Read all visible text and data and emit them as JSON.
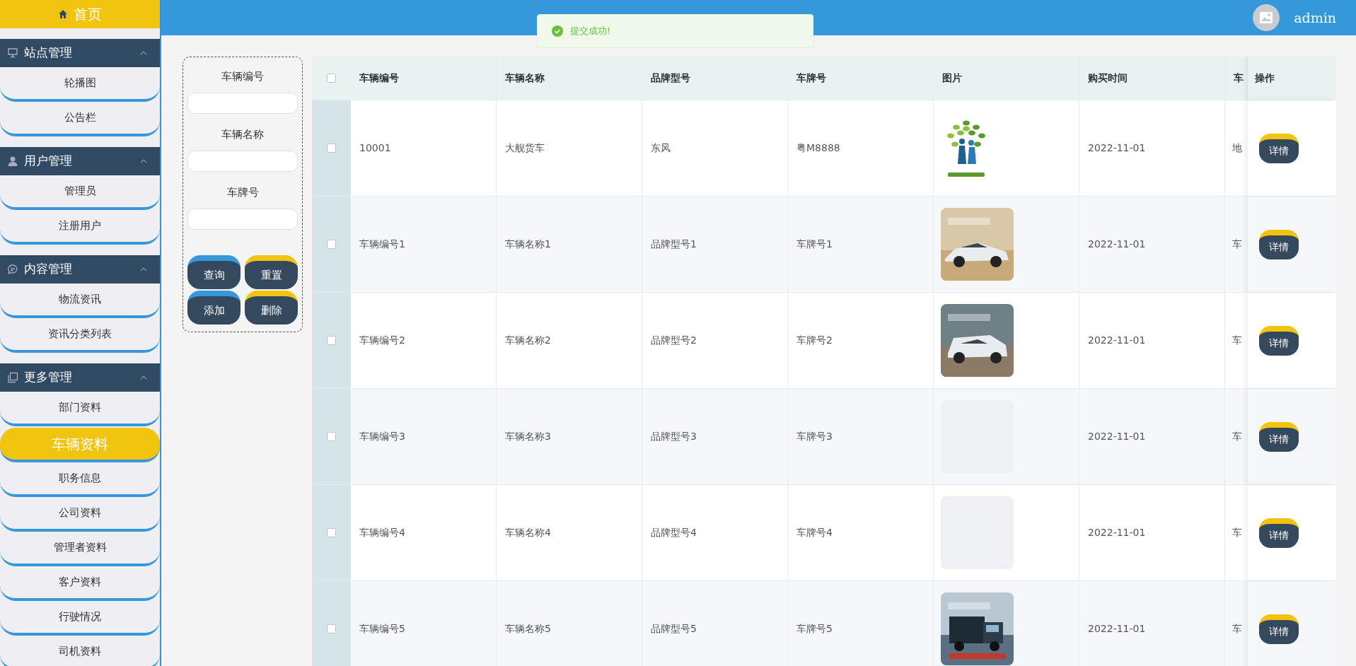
{
  "sidebar": {
    "home": {
      "label": "首页"
    },
    "groups": [
      {
        "title": "站点管理",
        "expanded": true,
        "items": [
          {
            "label": "轮播图",
            "selected": false
          },
          {
            "label": "公告栏",
            "selected": false
          }
        ]
      },
      {
        "title": "用户管理",
        "expanded": true,
        "items": [
          {
            "label": "管理员",
            "selected": false
          },
          {
            "label": "注册用户",
            "selected": false
          }
        ]
      },
      {
        "title": "内容管理",
        "expanded": true,
        "items": [
          {
            "label": "物流资讯",
            "selected": false
          },
          {
            "label": "资讯分类列表",
            "selected": false
          }
        ]
      },
      {
        "title": "更多管理",
        "expanded": true,
        "items": [
          {
            "label": "部门资料",
            "selected": false
          },
          {
            "label": "车辆资料",
            "selected": true
          },
          {
            "label": "职务信息",
            "selected": false
          },
          {
            "label": "公司资料",
            "selected": false
          },
          {
            "label": "管理者资料",
            "selected": false
          },
          {
            "label": "客户资料",
            "selected": false
          },
          {
            "label": "行驶情况",
            "selected": false
          },
          {
            "label": "司机资料",
            "selected": false
          }
        ]
      }
    ]
  },
  "header": {
    "user": "admin"
  },
  "toast": {
    "message": "提交成功!"
  },
  "search": {
    "fields": [
      {
        "label": "车辆编号"
      },
      {
        "label": "车辆名称"
      },
      {
        "label": "车牌号"
      }
    ],
    "buttons": [
      {
        "label": "查询",
        "color": "#3498db"
      },
      {
        "label": "重置",
        "color": "#f1c40f"
      },
      {
        "label": "添加",
        "color": "#3498db"
      },
      {
        "label": "删除",
        "color": "#f1c40f"
      }
    ]
  },
  "table": {
    "select_all_checked": false,
    "columns": [
      "车辆编号",
      "车辆名称",
      "品牌型号",
      "车牌号",
      "图片",
      "购买时间",
      "车"
    ],
    "action_column": "操作",
    "rows": [
      {
        "checked": false,
        "cells": [
          "10001",
          "大舰货车",
          "东风",
          "粤M8888"
        ],
        "image": {
          "kind": "logo"
        },
        "date": "2022-11-01",
        "column_7": "地",
        "action": "详情"
      },
      {
        "checked": false,
        "cells": [
          "车辆编号1",
          "车辆名称1",
          "品牌型号1",
          "车牌号1"
        ],
        "image": {
          "kind": "sportscar"
        },
        "date": "2022-11-01",
        "column_7": "车",
        "action": "详情"
      },
      {
        "checked": false,
        "cells": [
          "车辆编号2",
          "车辆名称2",
          "品牌型号2",
          "车牌号2"
        ],
        "image": {
          "kind": "suv"
        },
        "date": "2022-11-01",
        "column_7": "车",
        "action": "详情"
      },
      {
        "checked": false,
        "cells": [
          "车辆编号3",
          "车辆名称3",
          "品牌型号3",
          "车牌号3"
        ],
        "image": {
          "kind": "empty"
        },
        "date": "2022-11-01",
        "column_7": "车",
        "action": "详情"
      },
      {
        "checked": false,
        "cells": [
          "车辆编号4",
          "车辆名称4",
          "品牌型号4",
          "车牌号4"
        ],
        "image": {
          "kind": "empty"
        },
        "date": "2022-11-01",
        "column_7": "车",
        "action": "详情"
      },
      {
        "checked": false,
        "cells": [
          "车辆编号5",
          "车辆名称5",
          "品牌型号5",
          "车牌号5"
        ],
        "image": {
          "kind": "truck"
        },
        "date": "2022-11-01",
        "column_7": "车",
        "action": "详情"
      }
    ]
  }
}
